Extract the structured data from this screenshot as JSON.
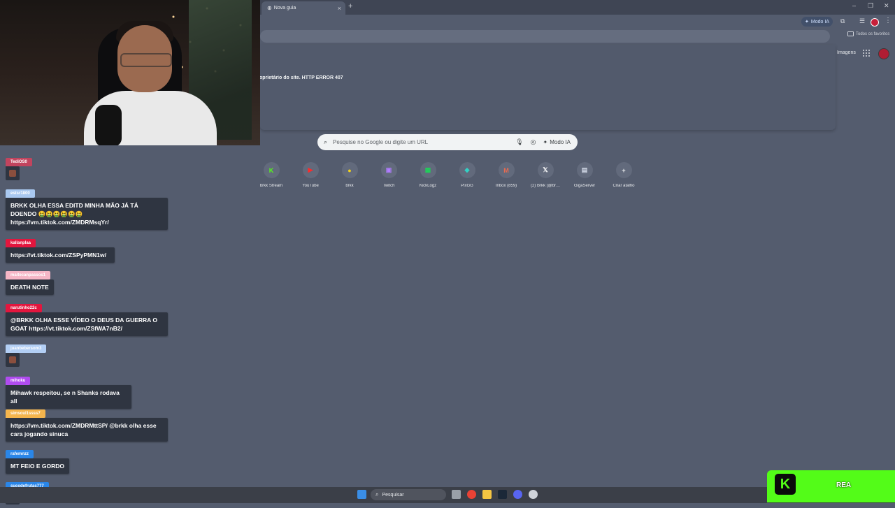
{
  "browser": {
    "tab_title": "Nova guia",
    "tab_icon": "globe-icon",
    "new_tab_symbol": "+",
    "window_controls": [
      "–",
      "❐",
      "✕"
    ],
    "ai_mode_label": "Modo IA",
    "bookmarks_label": "Todos os favoritos"
  },
  "page": {
    "error_text": "oprietário do site. HTTP ERROR 407",
    "images_link": "Imagens",
    "search_placeholder": "Pesquise no Google ou digite um URL",
    "search_ai_mode_label": "Modo IA",
    "shortcuts": [
      {
        "label": "brkk Stream",
        "icon": "kick-icon",
        "glyph": "K",
        "color": "#53fc18"
      },
      {
        "label": "YouTube",
        "icon": "youtube-icon",
        "glyph": "▶",
        "color": "#ff2a2a"
      },
      {
        "label": "brkk",
        "icon": "brkk-icon",
        "glyph": "●",
        "color": "#f2d21b"
      },
      {
        "label": "Twitch",
        "icon": "twitch-icon",
        "glyph": "▣",
        "color": "#b07cff"
      },
      {
        "label": "KickLogz",
        "icon": "kicklogz-icon",
        "glyph": "▦",
        "color": "#1fd05a"
      },
      {
        "label": "PixGG",
        "icon": "pixgg-icon",
        "glyph": "◆",
        "color": "#33d1c5"
      },
      {
        "label": "Inbox (859)",
        "icon": "gmail-icon",
        "glyph": "M",
        "color": "#ea6b50"
      },
      {
        "label": "(2) Brkk (@br…",
        "icon": "x-icon",
        "glyph": "𝕏",
        "color": "#ffffff"
      },
      {
        "label": "GigaServer",
        "icon": "gigaserver-icon",
        "glyph": "▤",
        "color": "#cfd6e4"
      },
      {
        "label": "Criar atalho",
        "icon": "plus-icon",
        "glyph": "+",
        "color": "#e8eaed"
      }
    ]
  },
  "chat": {
    "messages": [
      {
        "user": "TediOS0",
        "color": "#c2445e",
        "text": "",
        "emote": true
      },
      {
        "user": "estsr1800",
        "color": "#a9c8f0",
        "text": "BRKK OLHA ESSA EDITD MINHA MÃO JÁ TÁ DOENDO 🤮🤮🤮🤮🤮🤮 https://vm.tiktok.com/ZMDRMsqYr/",
        "emote": false
      },
      {
        "user": "kallanplaa",
        "color": "#e3163e",
        "text": "https://vt.tiktok.com/ZSPyPMN1w/",
        "emote": false
      },
      {
        "user": "maitecanpassos1",
        "color": "#f6b6c6",
        "text": "DEATH NOTE",
        "emote": false
      },
      {
        "user": "narutinho22c",
        "color": "#e3163e",
        "text": "@BRKK OLHA ESSE VÍDEO O DEUS DA GUERRA O GOAT https://vt.tiktok.com/ZSfWA7nB2/",
        "emote": false
      },
      {
        "user": "juanbebersom3",
        "color": "#b3cff5",
        "text": "",
        "emote": true
      },
      {
        "user": "mihoku",
        "color": "#b04cf0",
        "text": "Mihawk respeitou, se n Shanks rodava all",
        "emote": false
      },
      {
        "user": "simsoul1ssss7",
        "color": "#f5b54d",
        "text": "https://vm.tiktok.com/ZMDRMttSP/ @brkk olha esse cara jogando sinuca",
        "emote": false
      },
      {
        "user": "rafemnzz",
        "color": "#2a86e8",
        "text": "MT FEIO E GORDO",
        "emote": false
      },
      {
        "user": "sucodefrutas777",
        "color": "#2a86e8",
        "text": "",
        "emote": true
      }
    ]
  },
  "taskbar": {
    "search_label": "Pesquisar"
  },
  "overlay": {
    "kick_logo": "K",
    "kick_text": "REA"
  }
}
